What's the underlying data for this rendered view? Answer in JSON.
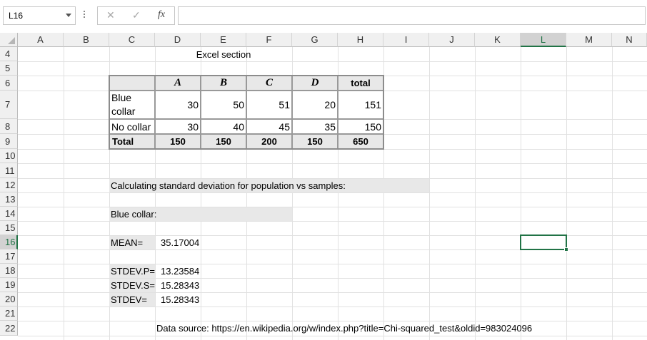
{
  "namebox": {
    "value": "L16"
  },
  "formula_bar": {
    "fx_label": "fx",
    "cancel": "✕",
    "enter": "✓",
    "content": ""
  },
  "columns": [
    "A",
    "B",
    "C",
    "D",
    "E",
    "F",
    "G",
    "H",
    "I",
    "J",
    "K",
    "L",
    "M",
    "N"
  ],
  "selected_column": "L",
  "rows": [
    "4",
    "5",
    "6",
    "7",
    "8",
    "9",
    "10",
    "11",
    "12",
    "13",
    "14",
    "15",
    "16",
    "17",
    "18",
    "19",
    "20",
    "21",
    "22"
  ],
  "selected_row": "16",
  "cells": {
    "title": "Excel section",
    "table": {
      "headers": [
        "A",
        "B",
        "C",
        "D",
        "total"
      ],
      "row1_label": "Blue\ncollar",
      "row1_label_l1": "Blue",
      "row1_label_l2": "collar",
      "row1": [
        "30",
        "50",
        "51",
        "20",
        "151"
      ],
      "row2_label": "No collar",
      "row2": [
        "30",
        "40",
        "45",
        "35",
        "150"
      ],
      "total_label": "Total",
      "totals": [
        "150",
        "150",
        "200",
        "150",
        "650"
      ]
    },
    "calc_heading": "Calculating standard deviation for population vs samples:",
    "blue_collar": "Blue collar:",
    "mean_label": "MEAN=",
    "mean_value": "35.17004",
    "stdevp_label": "STDEV.P=",
    "stdevp_value": "13.23584",
    "stdevs_label": "STDEV.S=",
    "stdevs_value": "15.28343",
    "stdev_label": "STDEV=",
    "stdev_value": "15.28343",
    "source": "Data source: https://en.wikipedia.org/w/index.php?title=Chi-squared_test&oldid=983024096"
  },
  "colors": {
    "accent": "#217346",
    "cell_fill": "#e8e8e8"
  }
}
